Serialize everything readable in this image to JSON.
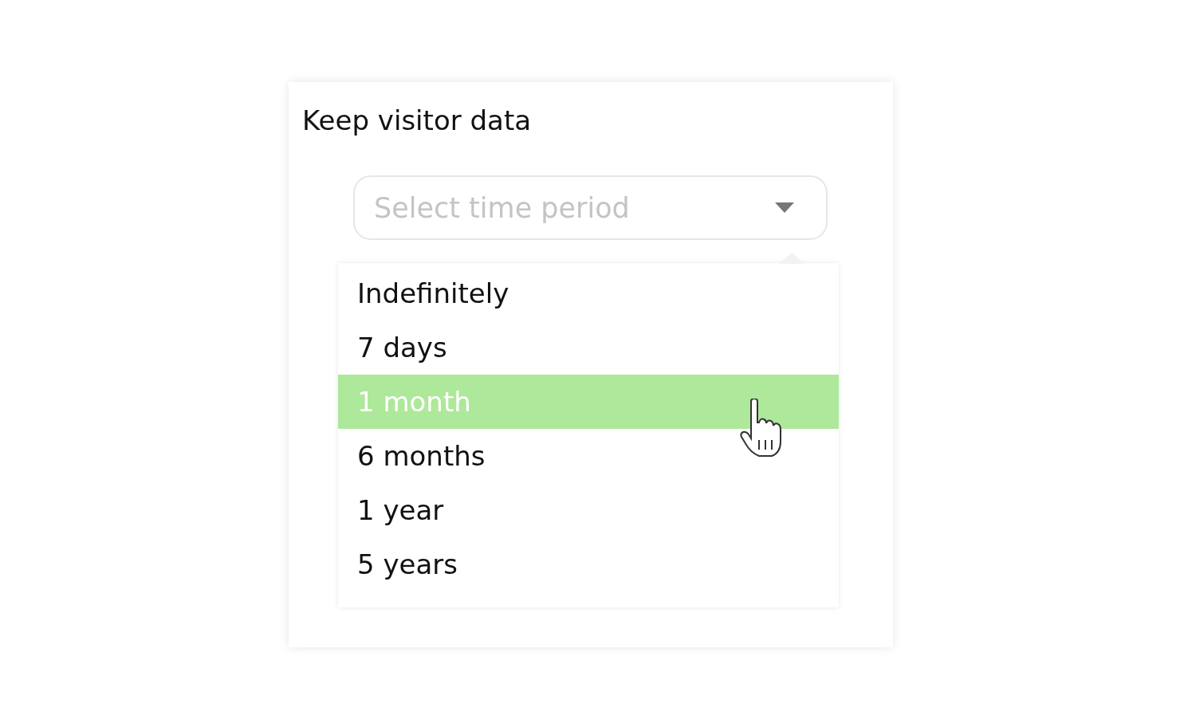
{
  "card": {
    "title": "Keep visitor data"
  },
  "select": {
    "placeholder": "Select time period",
    "expanded": true
  },
  "options": [
    {
      "label": "Indefinitely",
      "selected": false
    },
    {
      "label": "7 days",
      "selected": false
    },
    {
      "label": "1 month",
      "selected": true
    },
    {
      "label": "6 months",
      "selected": false
    },
    {
      "label": "1 year",
      "selected": false
    },
    {
      "label": "5 years",
      "selected": false
    }
  ]
}
